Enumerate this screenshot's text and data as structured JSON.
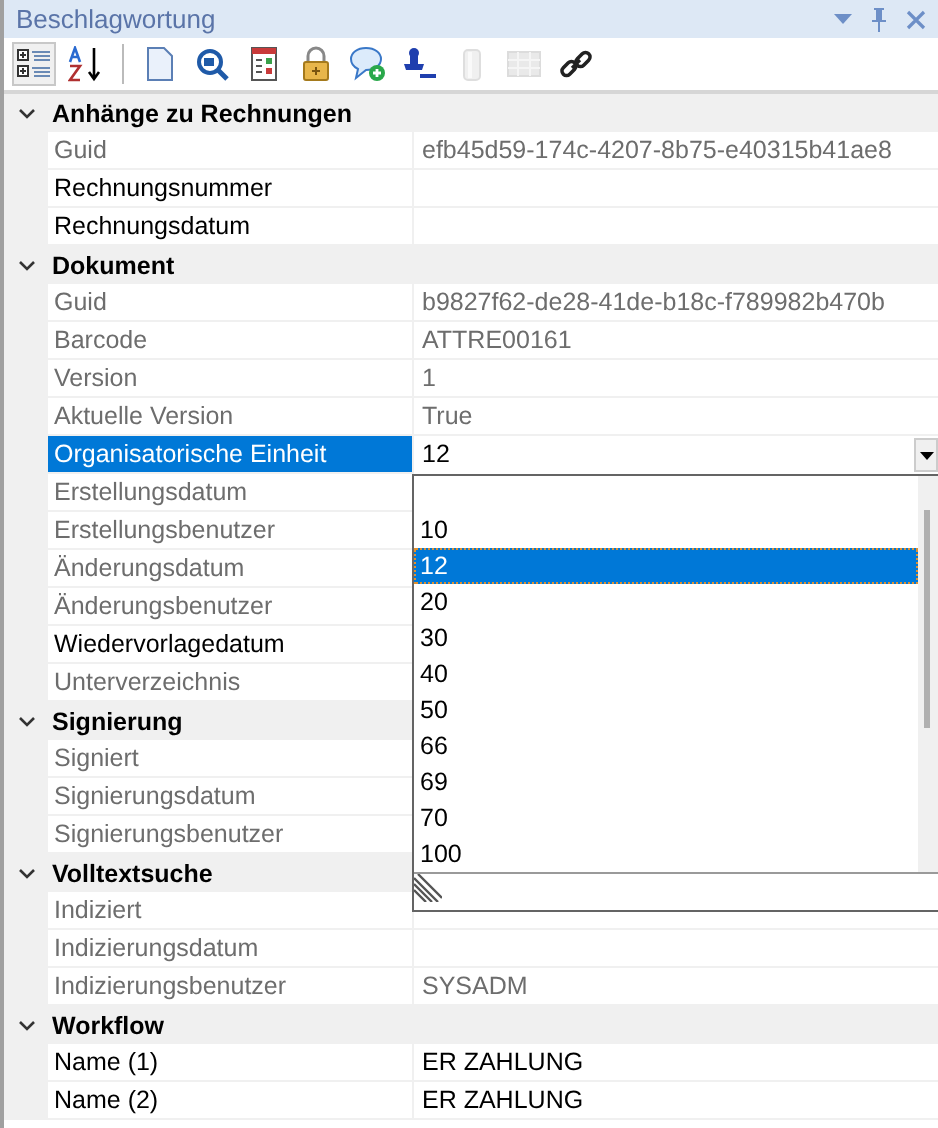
{
  "panel": {
    "title": "Beschlagwortung"
  },
  "toolbar": [
    {
      "kind": "categorized",
      "selected": true,
      "disabled": false
    },
    {
      "kind": "alphabetical",
      "selected": false,
      "disabled": false
    },
    {
      "kind": "page",
      "selected": false,
      "disabled": false
    },
    {
      "kind": "search",
      "selected": false,
      "disabled": false
    },
    {
      "kind": "form",
      "selected": false,
      "disabled": false
    },
    {
      "kind": "lock",
      "selected": false,
      "disabled": false
    },
    {
      "kind": "comment",
      "selected": false,
      "disabled": false
    },
    {
      "kind": "stamp",
      "selected": false,
      "disabled": false
    },
    {
      "kind": "cylinder",
      "selected": false,
      "disabled": true
    },
    {
      "kind": "grid",
      "selected": false,
      "disabled": true
    },
    {
      "kind": "link",
      "selected": false,
      "disabled": false
    }
  ],
  "categories": [
    {
      "title": "Anhänge zu Rechnungen",
      "expanded": true,
      "properties": [
        {
          "label": "Guid",
          "value": "efb45d59-174c-4207-8b75-e40315b41ae8",
          "readonly": true,
          "selected": false
        },
        {
          "label": "Rechnungsnummer",
          "readonly": false,
          "selected": false
        },
        {
          "label": "Rechnungsdatum",
          "readonly": false,
          "selected": false
        }
      ]
    },
    {
      "title": "Dokument",
      "expanded": true,
      "properties": [
        {
          "label": "Guid",
          "value": "b9827f62-de28-41de-b18c-f789982b470b",
          "readonly": true,
          "selected": false
        },
        {
          "label": "Barcode",
          "value": "ATTRE00161",
          "readonly": true,
          "selected": false
        },
        {
          "label": "Version",
          "value": "1",
          "readonly": true,
          "selected": false
        },
        {
          "label": "Aktuelle Version",
          "value": "True",
          "readonly": true,
          "selected": false
        },
        {
          "label": "Organisatorische Einheit",
          "value": "12",
          "readonly": false,
          "selected": true,
          "dropdown": {
            "options": [
              {
                "label": "10",
                "selected": false
              },
              {
                "label": "12",
                "selected": true
              },
              {
                "label": "20",
                "selected": false
              },
              {
                "label": "30",
                "selected": false
              },
              {
                "label": "40",
                "selected": false
              },
              {
                "label": "50",
                "selected": false
              },
              {
                "label": "66",
                "selected": false
              },
              {
                "label": "69",
                "selected": false
              },
              {
                "label": "70",
                "selected": false
              },
              {
                "label": "100",
                "selected": false
              }
            ]
          }
        },
        {
          "label": "Erstellungsdatum",
          "readonly": true,
          "selected": false
        },
        {
          "label": "Erstellungsbenutzer",
          "readonly": true,
          "selected": false
        },
        {
          "label": "Änderungsdatum",
          "readonly": true,
          "selected": false
        },
        {
          "label": "Änderungsbenutzer",
          "readonly": true,
          "selected": false
        },
        {
          "label": "Wiedervorlagedatum",
          "readonly": false,
          "selected": false
        },
        {
          "label": "Unterverzeichnis",
          "readonly": true,
          "selected": false
        }
      ]
    },
    {
      "title": "Signierung",
      "expanded": true,
      "properties": [
        {
          "label": "Signiert",
          "readonly": true,
          "selected": false
        },
        {
          "label": "Signierungsdatum",
          "readonly": true,
          "selected": false
        },
        {
          "label": "Signierungsbenutzer",
          "readonly": true,
          "selected": false
        }
      ]
    },
    {
      "title": "Volltextsuche",
      "expanded": true,
      "properties": [
        {
          "label": "Indiziert",
          "readonly": true,
          "selected": false
        },
        {
          "label": "Indizierungsdatum",
          "readonly": true,
          "selected": false
        },
        {
          "label": "Indizierungsbenutzer",
          "value": "SYSADM",
          "readonly": true,
          "selected": false
        }
      ]
    },
    {
      "title": "Workflow",
      "expanded": true,
      "properties": [
        {
          "label": "Name (1)",
          "value": "ER ZAHLUNG",
          "readonly": false,
          "selected": false
        },
        {
          "label": "Name (2)",
          "value": "ER ZAHLUNG",
          "readonly": false,
          "selected": false
        }
      ]
    }
  ]
}
